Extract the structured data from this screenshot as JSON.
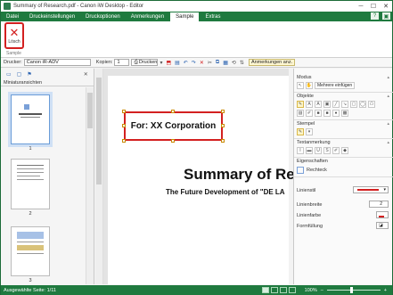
{
  "window": {
    "title": "Summary of Research.pdf - Canon iW Desktop - Editor",
    "minimize_glyph": "─",
    "maximize_glyph": "☐",
    "close_glyph": "✕"
  },
  "menu": {
    "tabs": [
      "Datei",
      "Druckeinstellungen",
      "Druckoptionen",
      "Anmerkungen",
      "Sample",
      "Extras"
    ],
    "active": "Sample",
    "help_glyph": "?",
    "options_glyph": "▣"
  },
  "ribbon": {
    "delete_label": "Lösch",
    "group_label": "Sample"
  },
  "toolbar": {
    "printer_label": "Drucker:",
    "printer_value": "Canon iR-ADV",
    "copies_label": "Kopien:",
    "copies_value": "1",
    "print_label": "Drucken",
    "annotations_button": "Anmerkungen anz."
  },
  "left_pane": {
    "header": "Miniaturansichten",
    "pages": [
      "1",
      "2",
      "3"
    ]
  },
  "document": {
    "annotation_text": "For: XX Corporation",
    "title": "Summary of Res",
    "subtitle": "The Future Development of \"DE LA"
  },
  "right_pane": {
    "modus_label": "Modus",
    "multi_insert_label": "Mehrere einfügen",
    "objects_label": "Objekte",
    "stamp_label": "Stempel",
    "text_mark_label": "Textanmerkung",
    "properties_label": "Eigenschaften",
    "rect_label": "Rechteck",
    "line_label": "Linienstil",
    "width_label": "Linienbreite",
    "width_value": "2",
    "color_label": "Linienfarbe",
    "fill_label": "Formfüllung"
  },
  "status": {
    "text": "Ausgewählte Seite: 1/11",
    "zoom": "100%"
  },
  "colors": {
    "brand": "#1f7a3f",
    "annotation": "#d32020"
  }
}
